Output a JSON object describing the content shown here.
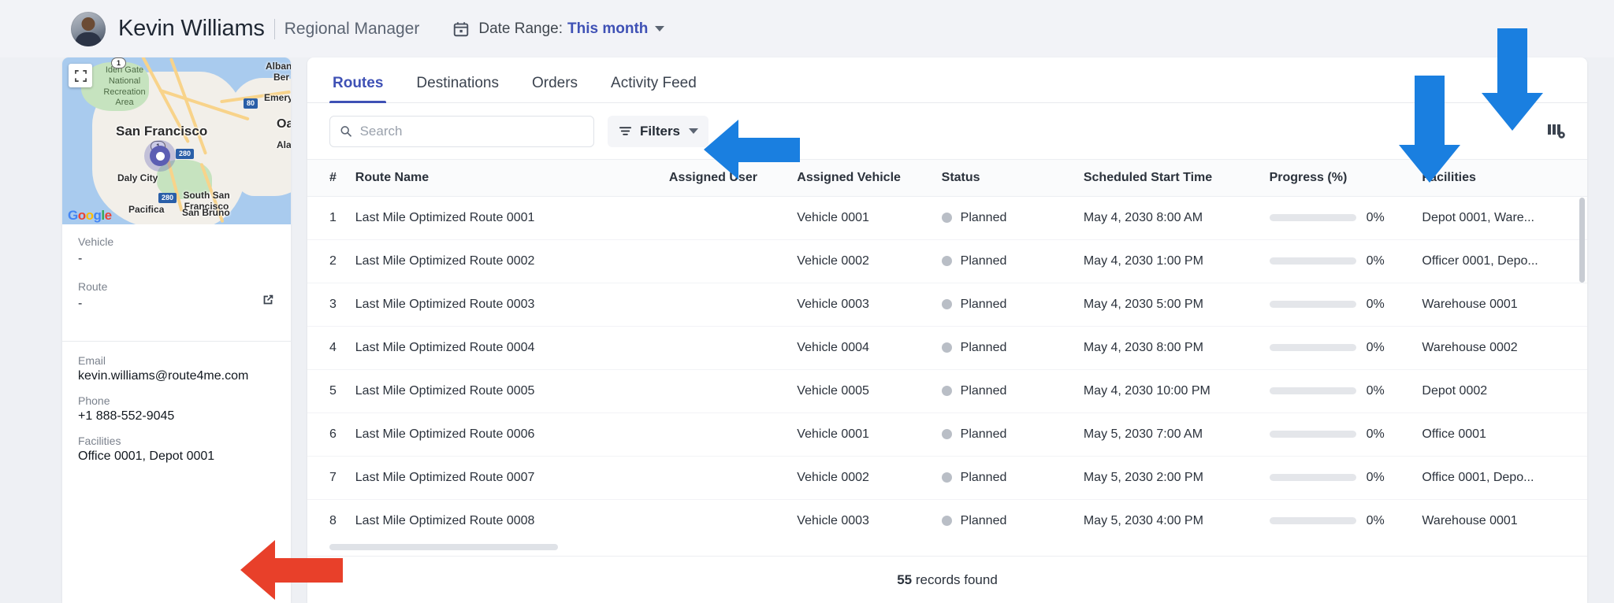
{
  "header": {
    "user_name": "Kevin Williams",
    "user_role": "Regional Manager",
    "date_range_label": "Date Range:",
    "date_range_value": "This month",
    "calendar_icon": "calendar-icon",
    "avatar": "user-avatar"
  },
  "sidebar": {
    "map": {
      "provider_logo": "Google",
      "expand_icon": "expand-map-icon",
      "marker_icon": "location-marker-icon",
      "labels": {
        "park": "Iden Gate\\nNational\\nRecreation\\nArea",
        "city": "San Francisco",
        "daly_city": "Daly City",
        "south_sf": "South San\\nFrancisco",
        "pacifica": "Pacifica",
        "san_bruno": "San Bruno",
        "oakland": "Oa",
        "alameda": "Alam",
        "albany": "Alban",
        "berkeley": "Ber",
        "emeryville": "Emery",
        "hwy80": "80",
        "hwy280": "280",
        "hwy280b": "280",
        "hwy1": "1",
        "hwy1b": "1"
      }
    },
    "fields": [
      {
        "label": "Vehicle",
        "value": "-"
      },
      {
        "label": "Route",
        "value": "-"
      }
    ],
    "route_external_link_icon": "external-link-icon",
    "contact": [
      {
        "label": "Email",
        "value": "kevin.williams@route4me.com"
      },
      {
        "label": "Phone",
        "value": "+1 888-552-9045"
      },
      {
        "label": "Facilities",
        "value": "Office 0001, Depot 0001"
      }
    ]
  },
  "main": {
    "tabs": [
      {
        "label": "Routes",
        "active": true
      },
      {
        "label": "Destinations",
        "active": false
      },
      {
        "label": "Orders",
        "active": false
      },
      {
        "label": "Activity Feed",
        "active": false
      }
    ],
    "toolbar": {
      "search_placeholder": "Search",
      "search_value": "",
      "search_icon": "search-icon",
      "filters_label": "Filters",
      "filters_icon": "filter-icon",
      "filters_caret_icon": "chevron-down-icon",
      "columns_settings_icon": "columns-settings-icon"
    },
    "table": {
      "columns": [
        "#",
        "Route Name",
        "Assigned User",
        "Assigned Vehicle",
        "Status",
        "Scheduled Start Time",
        "Progress (%)",
        "Facilities"
      ],
      "rows": [
        {
          "num": "1",
          "name": "Last Mile Optimized Route 0001",
          "user": "",
          "vehicle": "Vehicle 0001",
          "status": "Planned",
          "time": "May 4, 2030 8:00 AM",
          "progress": "0%",
          "progress_value": 0,
          "facilities": "Depot 0001, Ware..."
        },
        {
          "num": "2",
          "name": "Last Mile Optimized Route 0002",
          "user": "",
          "vehicle": "Vehicle 0002",
          "status": "Planned",
          "time": "May 4, 2030 1:00 PM",
          "progress": "0%",
          "progress_value": 0,
          "facilities": "Officer 0001, Depo..."
        },
        {
          "num": "3",
          "name": "Last Mile Optimized Route 0003",
          "user": "",
          "vehicle": "Vehicle 0003",
          "status": "Planned",
          "time": "May 4, 2030 5:00 PM",
          "progress": "0%",
          "progress_value": 0,
          "facilities": "Warehouse 0001"
        },
        {
          "num": "4",
          "name": "Last Mile Optimized Route 0004",
          "user": "",
          "vehicle": "Vehicle 0004",
          "status": "Planned",
          "time": "May 4, 2030 8:00 PM",
          "progress": "0%",
          "progress_value": 0,
          "facilities": "Warehouse 0002"
        },
        {
          "num": "5",
          "name": "Last Mile Optimized Route 0005",
          "user": "",
          "vehicle": "Vehicle 0005",
          "status": "Planned",
          "time": "May 4, 2030 10:00 PM",
          "progress": "0%",
          "progress_value": 0,
          "facilities": "Depot 0002"
        },
        {
          "num": "6",
          "name": "Last Mile Optimized Route 0006",
          "user": "",
          "vehicle": "Vehicle 0001",
          "status": "Planned",
          "time": "May 5, 2030 7:00 AM",
          "progress": "0%",
          "progress_value": 0,
          "facilities": "Office 0001"
        },
        {
          "num": "7",
          "name": "Last Mile Optimized Route 0007",
          "user": "",
          "vehicle": "Vehicle 0002",
          "status": "Planned",
          "time": "May 5, 2030 2:00 PM",
          "progress": "0%",
          "progress_value": 0,
          "facilities": "Office 0001, Depo..."
        },
        {
          "num": "8",
          "name": "Last Mile Optimized Route 0008",
          "user": "",
          "vehicle": "Vehicle 0003",
          "status": "Planned",
          "time": "May 5, 2030 4:00 PM",
          "progress": "0%",
          "progress_value": 0,
          "facilities": "Warehouse 0001"
        }
      ]
    },
    "footer": {
      "records_count": "55",
      "records_label": "records found"
    }
  },
  "annotations": {
    "arrow_filters": "blue-arrow-pointing-left-at-filters",
    "arrow_facilities_column": "blue-arrow-pointing-down-at-facilities-column",
    "arrow_columns_settings": "blue-arrow-pointing-down-at-columns-settings",
    "arrow_sidebar_facilities": "red-arrow-pointing-left-at-sidebar-facilities"
  },
  "colors": {
    "accent": "#3f51b5",
    "annotation_blue": "#1a7fe0",
    "annotation_red": "#e8402a",
    "status_dot": "#b9bec6",
    "page_bg": "#eef0f4"
  }
}
